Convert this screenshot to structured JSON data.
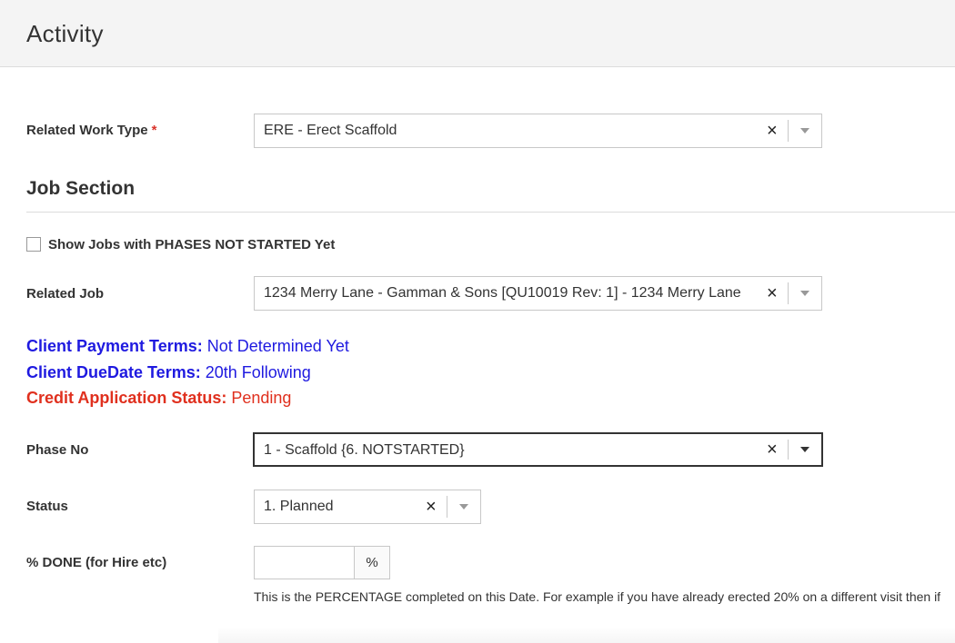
{
  "header": {
    "title": "Activity"
  },
  "work_type": {
    "label": "Related Work Type",
    "required_mark": "*",
    "value": "ERE - Erect Scaffold",
    "clear": "×"
  },
  "job_section": {
    "title": "Job Section",
    "show_not_started_label": "Show Jobs with PHASES NOT STARTED Yet",
    "show_not_started_checked": false,
    "related_job_label": "Related Job",
    "related_job_value": "1234 Merry Lane - Gamman & Sons [QU10019 Rev: 1] - 1234 Merry Lane",
    "clear": "×"
  },
  "terms": {
    "payment_key": "Client Payment Terms:",
    "payment_value": "Not Determined Yet",
    "duedate_key": "Client DueDate Terms:",
    "duedate_value": "20th Following",
    "credit_key": "Credit Application Status:",
    "credit_value": "Pending",
    "colors": {
      "info": "#1f1ae0",
      "warning": "#e0301e"
    }
  },
  "phase": {
    "label": "Phase No",
    "value": "1 - Scaffold {6. NOTSTARTED}",
    "clear": "×"
  },
  "status": {
    "label": "Status",
    "value": "1. Planned",
    "clear": "×"
  },
  "percent_done": {
    "label": "% DONE (for Hire etc)",
    "value": "",
    "addon": "%",
    "help": "This is the PERCENTAGE completed on this Date. For example if you have already erected 20% on a different visit then if"
  }
}
